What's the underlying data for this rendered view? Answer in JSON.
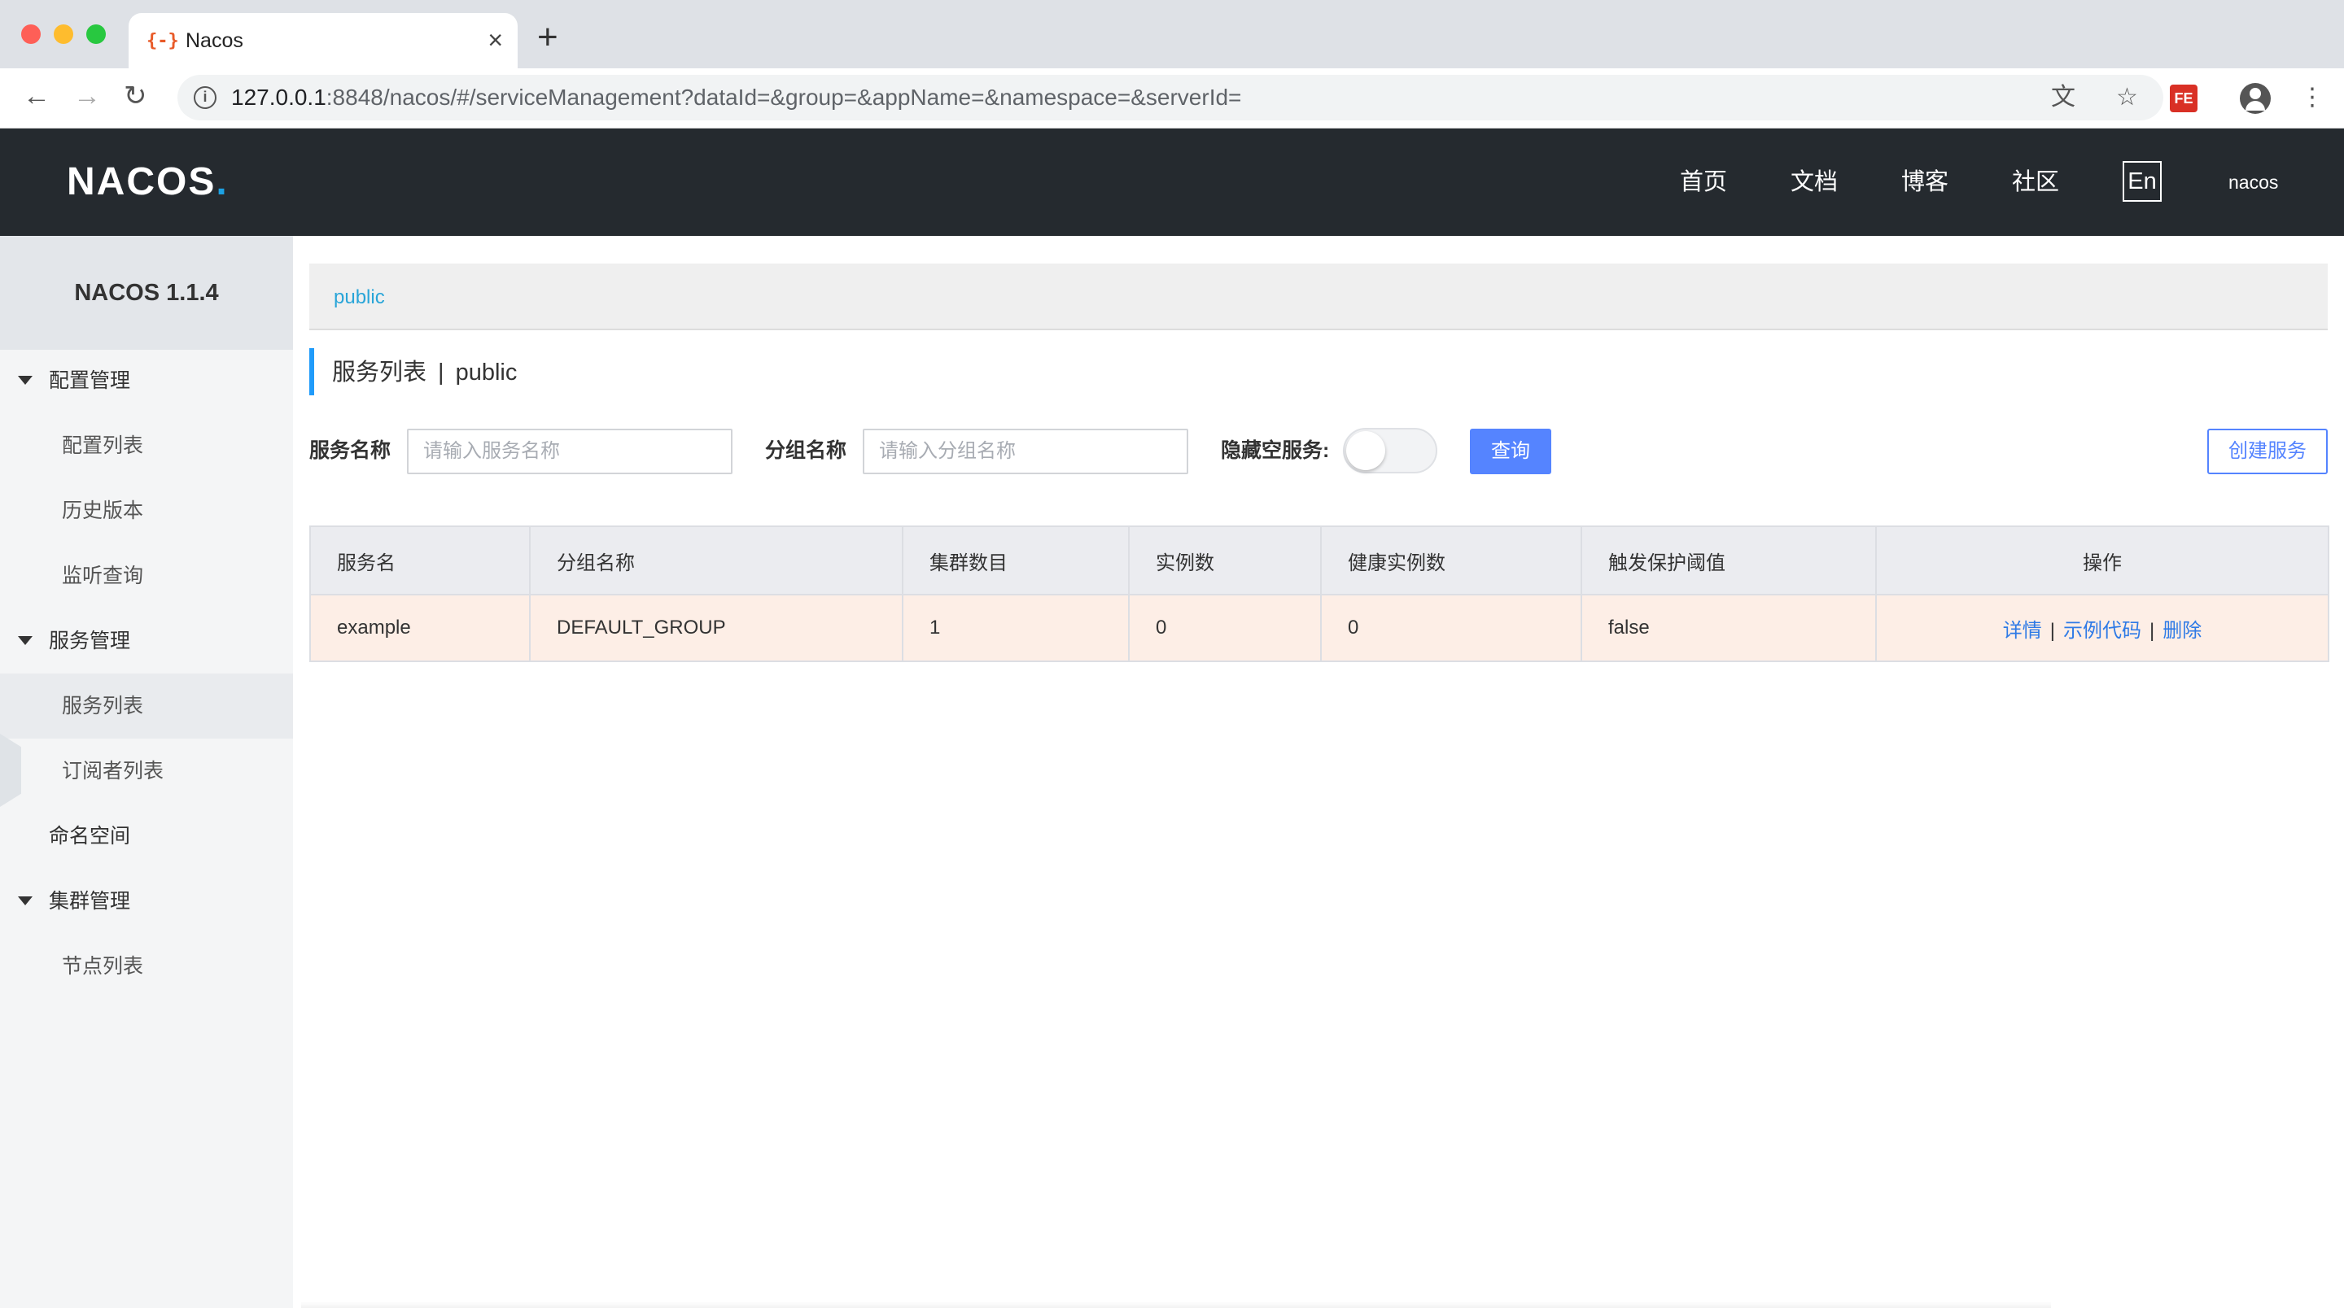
{
  "browser": {
    "tab_title": "Nacos",
    "tab_favicon": "{-}",
    "tab_close": "×",
    "new_tab": "+",
    "url_host": "127.0.0.1",
    "url_path": ":8848/nacos/#/serviceManagement?dataId=&group=&appName=&namespace=&serverId=",
    "back": "←",
    "forward": "→",
    "reload": "↻",
    "translate_icon": "文",
    "star_icon": "☆",
    "extension_label": "FE",
    "menu_icon": "⋮"
  },
  "header": {
    "logo": "NACOS",
    "logo_dot": ".",
    "nav": [
      "首页",
      "文档",
      "博客",
      "社区"
    ],
    "language": "En",
    "user": "nacos"
  },
  "sidebar": {
    "version": "NACOS 1.1.4",
    "groups": [
      {
        "label": "配置管理",
        "items": [
          "配置列表",
          "历史版本",
          "监听查询"
        ]
      },
      {
        "label": "服务管理",
        "items": [
          "服务列表",
          "订阅者列表"
        ]
      },
      {
        "label": "命名空间"
      },
      {
        "label": "集群管理",
        "items": [
          "节点列表"
        ]
      }
    ],
    "active_item": "服务列表"
  },
  "main": {
    "namespace": "public",
    "title": "服务列表",
    "title_sep": "|",
    "title_namespace": "public",
    "filters": {
      "service_name_label": "服务名称",
      "service_name_placeholder": "请输入服务名称",
      "group_name_label": "分组名称",
      "group_name_placeholder": "请输入分组名称",
      "hide_empty_label": "隐藏空服务:",
      "hide_empty_on": false,
      "query_button": "查询",
      "create_button": "创建服务"
    },
    "table": {
      "columns": [
        "服务名",
        "分组名称",
        "集群数目",
        "实例数",
        "健康实例数",
        "触发保护阈值",
        "操作"
      ],
      "rows": [
        {
          "service": "example",
          "group": "DEFAULT_GROUP",
          "clusters": "1",
          "instances": "0",
          "healthy": "0",
          "threshold": "false",
          "ops": [
            "详情",
            "示例代码",
            "删除"
          ]
        }
      ],
      "op_separator": "|"
    }
  },
  "colors": {
    "header_bg": "#252a2f",
    "accent_blue": "#5584ff",
    "link_blue": "#2e7ae6",
    "namespace_blue": "#29a5d8",
    "row_highlight": "#fdeee6"
  }
}
